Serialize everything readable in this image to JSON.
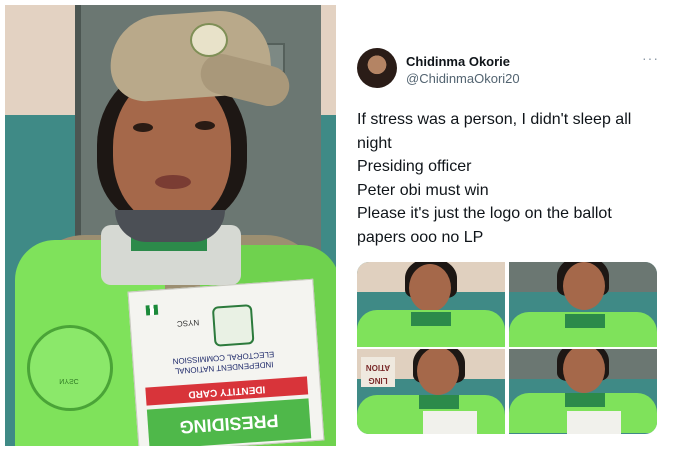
{
  "tweet": {
    "author": {
      "name": "Chidinma Okorie",
      "handle": "@ChidinmaOkori20"
    },
    "more_menu_label": "···",
    "text_lines": [
      "If stress was a person, I didn't sleep all",
      "night",
      "Presiding officer",
      "Peter obi must win",
      "Please it's just the logo on the ballot",
      "papers ooo no LP"
    ],
    "media_count": 4
  },
  "photo": {
    "id_card": {
      "small_label": "NYSC",
      "org_name_line1": "INDEPENDENT NATIONAL",
      "org_name_line2": "ELECTORAL COMMISSION",
      "band_red": "IDENTITY CARD",
      "band_green": "PRESIDING"
    },
    "vest_emblem_text": "NYSC",
    "tile_sign_text": "LING\nATION"
  },
  "colors": {
    "vest_green": "#7fe25b",
    "wall_teal": "#3f8a86",
    "card_red": "#d8343a",
    "card_green": "#4fb84a"
  }
}
